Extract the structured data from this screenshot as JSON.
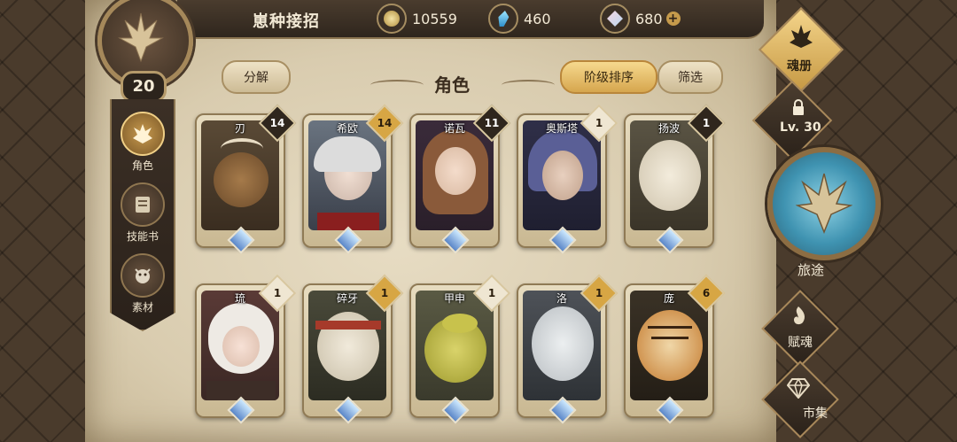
{
  "header": {
    "title": "崽种接招",
    "resources": [
      {
        "icon": "coin-icon",
        "value": "10559"
      },
      {
        "icon": "blue-crystal-icon",
        "value": "460"
      },
      {
        "icon": "pink-gem-icon",
        "value": "680"
      }
    ],
    "plus_label": "+"
  },
  "player": {
    "level": "20"
  },
  "left_menu": [
    {
      "label": "角色",
      "icon": "character-icon",
      "active": true
    },
    {
      "label": "技能书",
      "icon": "skillbook-icon",
      "active": false
    },
    {
      "label": "素材",
      "icon": "material-icon",
      "active": false
    }
  ],
  "toolbar": {
    "decompose_label": "分解",
    "heading": "角色",
    "sort_label": "阶级排序",
    "filter_label": "筛选"
  },
  "cards": [
    {
      "name": "刃",
      "count": "14",
      "badge": "dark"
    },
    {
      "name": "希欧",
      "count": "14",
      "badge": "gold"
    },
    {
      "name": "诺瓦",
      "count": "11",
      "badge": "dark"
    },
    {
      "name": "奥斯塔",
      "count": "1",
      "badge": "light"
    },
    {
      "name": "扬波",
      "count": "1",
      "badge": "dark"
    },
    {
      "name": "琉",
      "count": "1",
      "badge": "light"
    },
    {
      "name": "碎牙",
      "count": "1",
      "badge": "gold"
    },
    {
      "name": "甲申",
      "count": "1",
      "badge": "light"
    },
    {
      "name": "洛",
      "count": "1",
      "badge": "gold"
    },
    {
      "name": "庞",
      "count": "6",
      "badge": "gold"
    }
  ],
  "right_nav": {
    "soulbook": "魂册",
    "lock_level": "Lv. 30",
    "journey": "旅途",
    "fusoul": "赋魂",
    "market": "市集"
  },
  "colors": {
    "accent_gold": "#d6a64e",
    "frame_brown": "#8f7a55",
    "dark_badge": "#2f261d"
  }
}
